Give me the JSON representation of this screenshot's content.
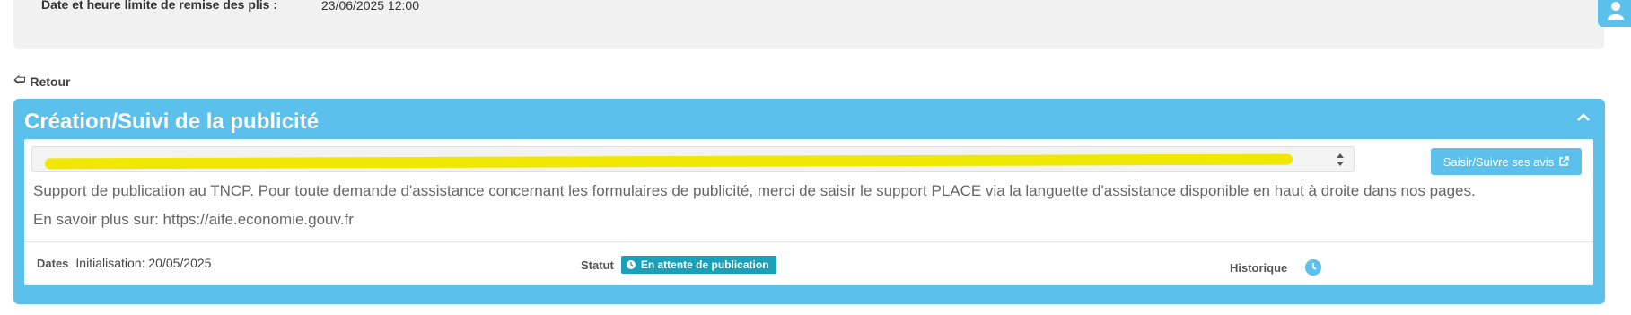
{
  "top": {
    "deadline_label": "Date et heure limite de remise des plis :",
    "deadline_value": "23/06/2025 12:00"
  },
  "back": {
    "label": "Retour",
    "icon": "arrow-left-icon"
  },
  "panel": {
    "title": "Création/Suivi de la publicité",
    "collapse_icon": "chevron-up-icon",
    "select_value": "",
    "button_label": "Saisir/Suivre ses avis",
    "button_icon": "external-link-icon",
    "info_line1": "Support de publication au TNCP. Pour toute demande d'assistance concernant les formulaires de publicité, merci de saisir le support PLACE via la languette d'assistance disponible en haut à droite dans nos pages.",
    "info_line2": "En savoir plus sur: https://aife.economie.gouv.fr",
    "dates_label": "Dates",
    "dates_value": "Initialisation: 20/05/2025",
    "statut_label": "Statut",
    "statut_value": "En attente de publication",
    "historique_label": "Historique"
  },
  "colors": {
    "accent": "#5bc0eb",
    "status": "#1aa0b8",
    "highlight": "#f0e800",
    "top_panel": "#f2f1f1"
  }
}
